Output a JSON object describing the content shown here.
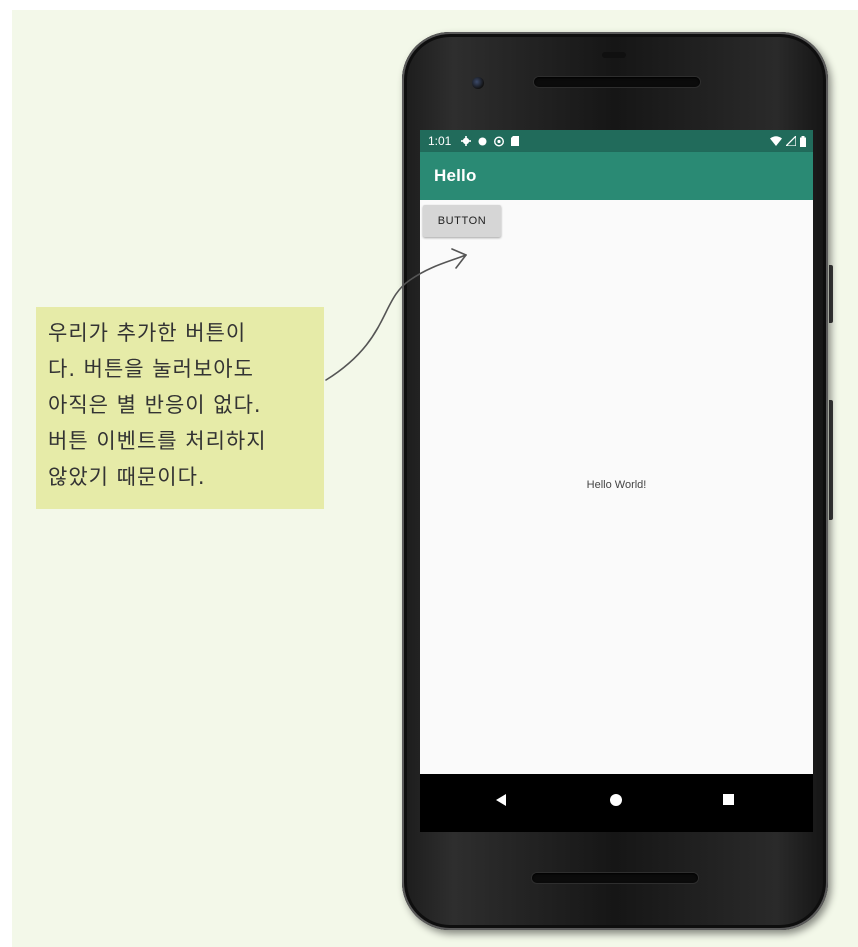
{
  "status_bar": {
    "time": "1:01"
  },
  "app_bar": {
    "title": "Hello"
  },
  "content": {
    "button_label": "BUTTON",
    "hello_text": "Hello World!"
  },
  "annotation": {
    "lines": [
      "우리가 추가한 버튼이",
      "다. 버튼을 눌러보아도",
      "아직은 별 반응이 없다.",
      "버튼 이벤트를 처리하지",
      "않았기 때문이다."
    ]
  },
  "colors": {
    "background": "#f3f8e9",
    "note": "#e6eba8",
    "status_bar": "#216b5b",
    "app_bar": "#2a8a74",
    "button": "#d6d6d6"
  },
  "icons": {
    "status_left": [
      "gear-icon",
      "dot-icon",
      "shield-icon",
      "sd-card-icon"
    ],
    "status_right": [
      "wifi-icon",
      "signal-icon",
      "battery-icon"
    ],
    "nav": [
      "back-icon",
      "home-icon",
      "recents-icon"
    ]
  }
}
